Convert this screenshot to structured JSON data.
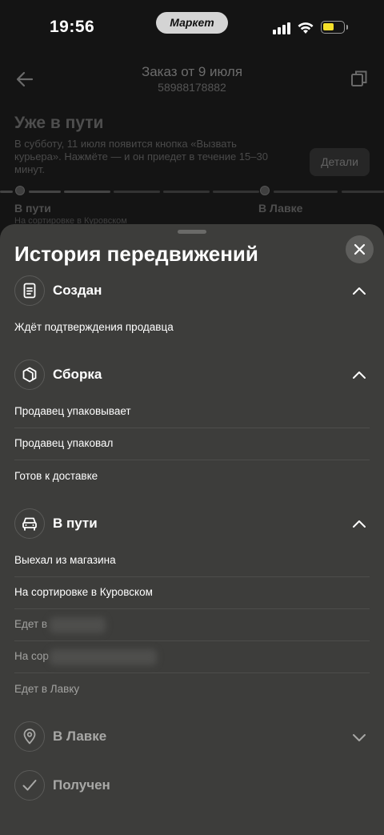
{
  "status_bar": {
    "time": "19:56",
    "app_pill": "Маркет"
  },
  "header": {
    "title": "Заказ от 9 июля",
    "order_number": "58988178882"
  },
  "order_status": {
    "title": "Уже в пути",
    "description": "В субботу, 11 июля появится кнопка «Вызвать курьера». Нажмёте — и он приедет в течение 15–30 минут.",
    "details_button": "Детали"
  },
  "progress": {
    "step1_label": "В пути",
    "step1_sublabel": "На сортировке в Куровском",
    "step2_label": "В Лавке"
  },
  "sheet": {
    "title": "История передвижений",
    "groups": [
      {
        "title": "Создан",
        "icon": "document-icon",
        "expanded": true,
        "events": [
          "Ждёт подтверждения продавца"
        ]
      },
      {
        "title": "Сборка",
        "icon": "box-icon",
        "expanded": true,
        "events": [
          "Продавец упаковывает",
          "Продавец упаковал",
          "Готов к доставке"
        ]
      },
      {
        "title": "В пути",
        "icon": "car-icon",
        "expanded": true,
        "events": [
          "Выехал из магазина",
          "На сортировке в Куровском",
          "Едет в",
          "На сор",
          "Едет в Лавку"
        ]
      },
      {
        "title": "В Лавке",
        "icon": "location-pin-icon",
        "expanded": false,
        "events": []
      },
      {
        "title": "Получен",
        "icon": "checkmark-icon",
        "expanded": false,
        "events": []
      }
    ]
  }
}
